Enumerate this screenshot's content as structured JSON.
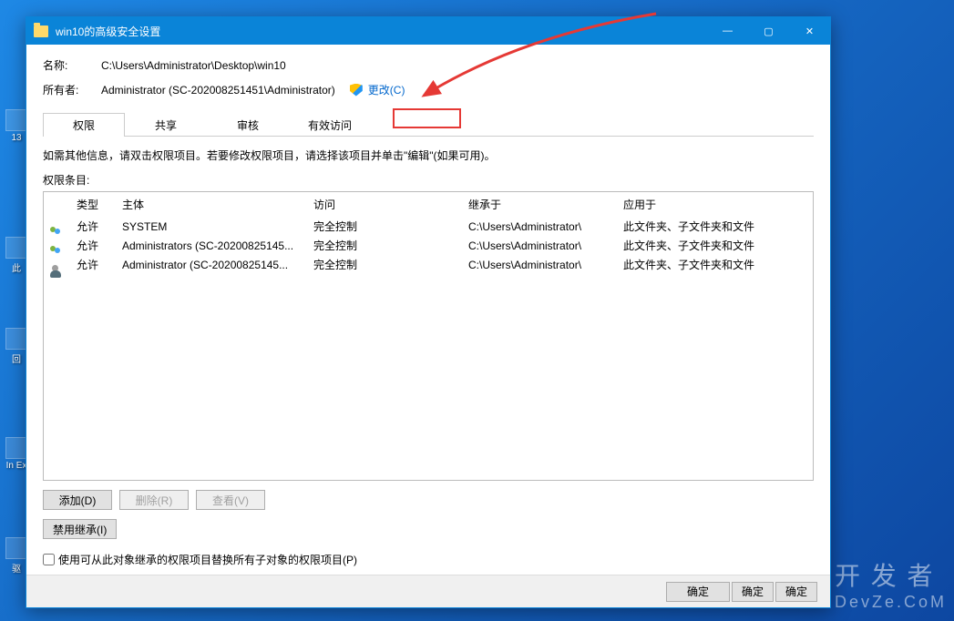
{
  "window": {
    "title": "win10的高级安全设置"
  },
  "info": {
    "name_label": "名称:",
    "name_value": "C:\\Users\\Administrator\\Desktop\\win10",
    "owner_label": "所有者:",
    "owner_value": "Administrator (SC-202008251451\\Administrator)",
    "change_link": "更改(C)"
  },
  "tabs": {
    "permissions": "权限",
    "share": "共享",
    "audit": "审核",
    "effective": "有效访问"
  },
  "instruction": "如需其他信息，请双击权限项目。若要修改权限项目，请选择该项目并单击\"编辑\"(如果可用)。",
  "perm_section_label": "权限条目:",
  "perm_headers": {
    "type": "类型",
    "principal": "主体",
    "access": "访问",
    "inherited_from": "继承于",
    "applies_to": "应用于"
  },
  "perm_entries": [
    {
      "icon": "group",
      "type": "允许",
      "principal": "SYSTEM",
      "access": "完全控制",
      "inherited": "C:\\Users\\Administrator\\",
      "applies": "此文件夹、子文件夹和文件"
    },
    {
      "icon": "group",
      "type": "允许",
      "principal": "Administrators (SC-20200825145...",
      "access": "完全控制",
      "inherited": "C:\\Users\\Administrator\\",
      "applies": "此文件夹、子文件夹和文件"
    },
    {
      "icon": "user",
      "type": "允许",
      "principal": "Administrator (SC-20200825145...",
      "access": "完全控制",
      "inherited": "C:\\Users\\Administrator\\",
      "applies": "此文件夹、子文件夹和文件"
    }
  ],
  "buttons": {
    "add": "添加(D)",
    "remove": "删除(R)",
    "view": "查看(V)",
    "disable_inherit": "禁用继承(I)"
  },
  "checkbox_label": "使用可从此对象继承的权限项目替换所有子对象的权限项目(P)",
  "footer": {
    "ok": "确定",
    "ok2": "确定",
    "ok3": "确定"
  },
  "desktop_labels": {
    "i1": "13",
    "i2": "此",
    "i3": "回",
    "i4": "In Ex",
    "i5": "驱"
  },
  "watermark": {
    "line1": "开 发 者",
    "line2": "DevZe.CoM"
  }
}
